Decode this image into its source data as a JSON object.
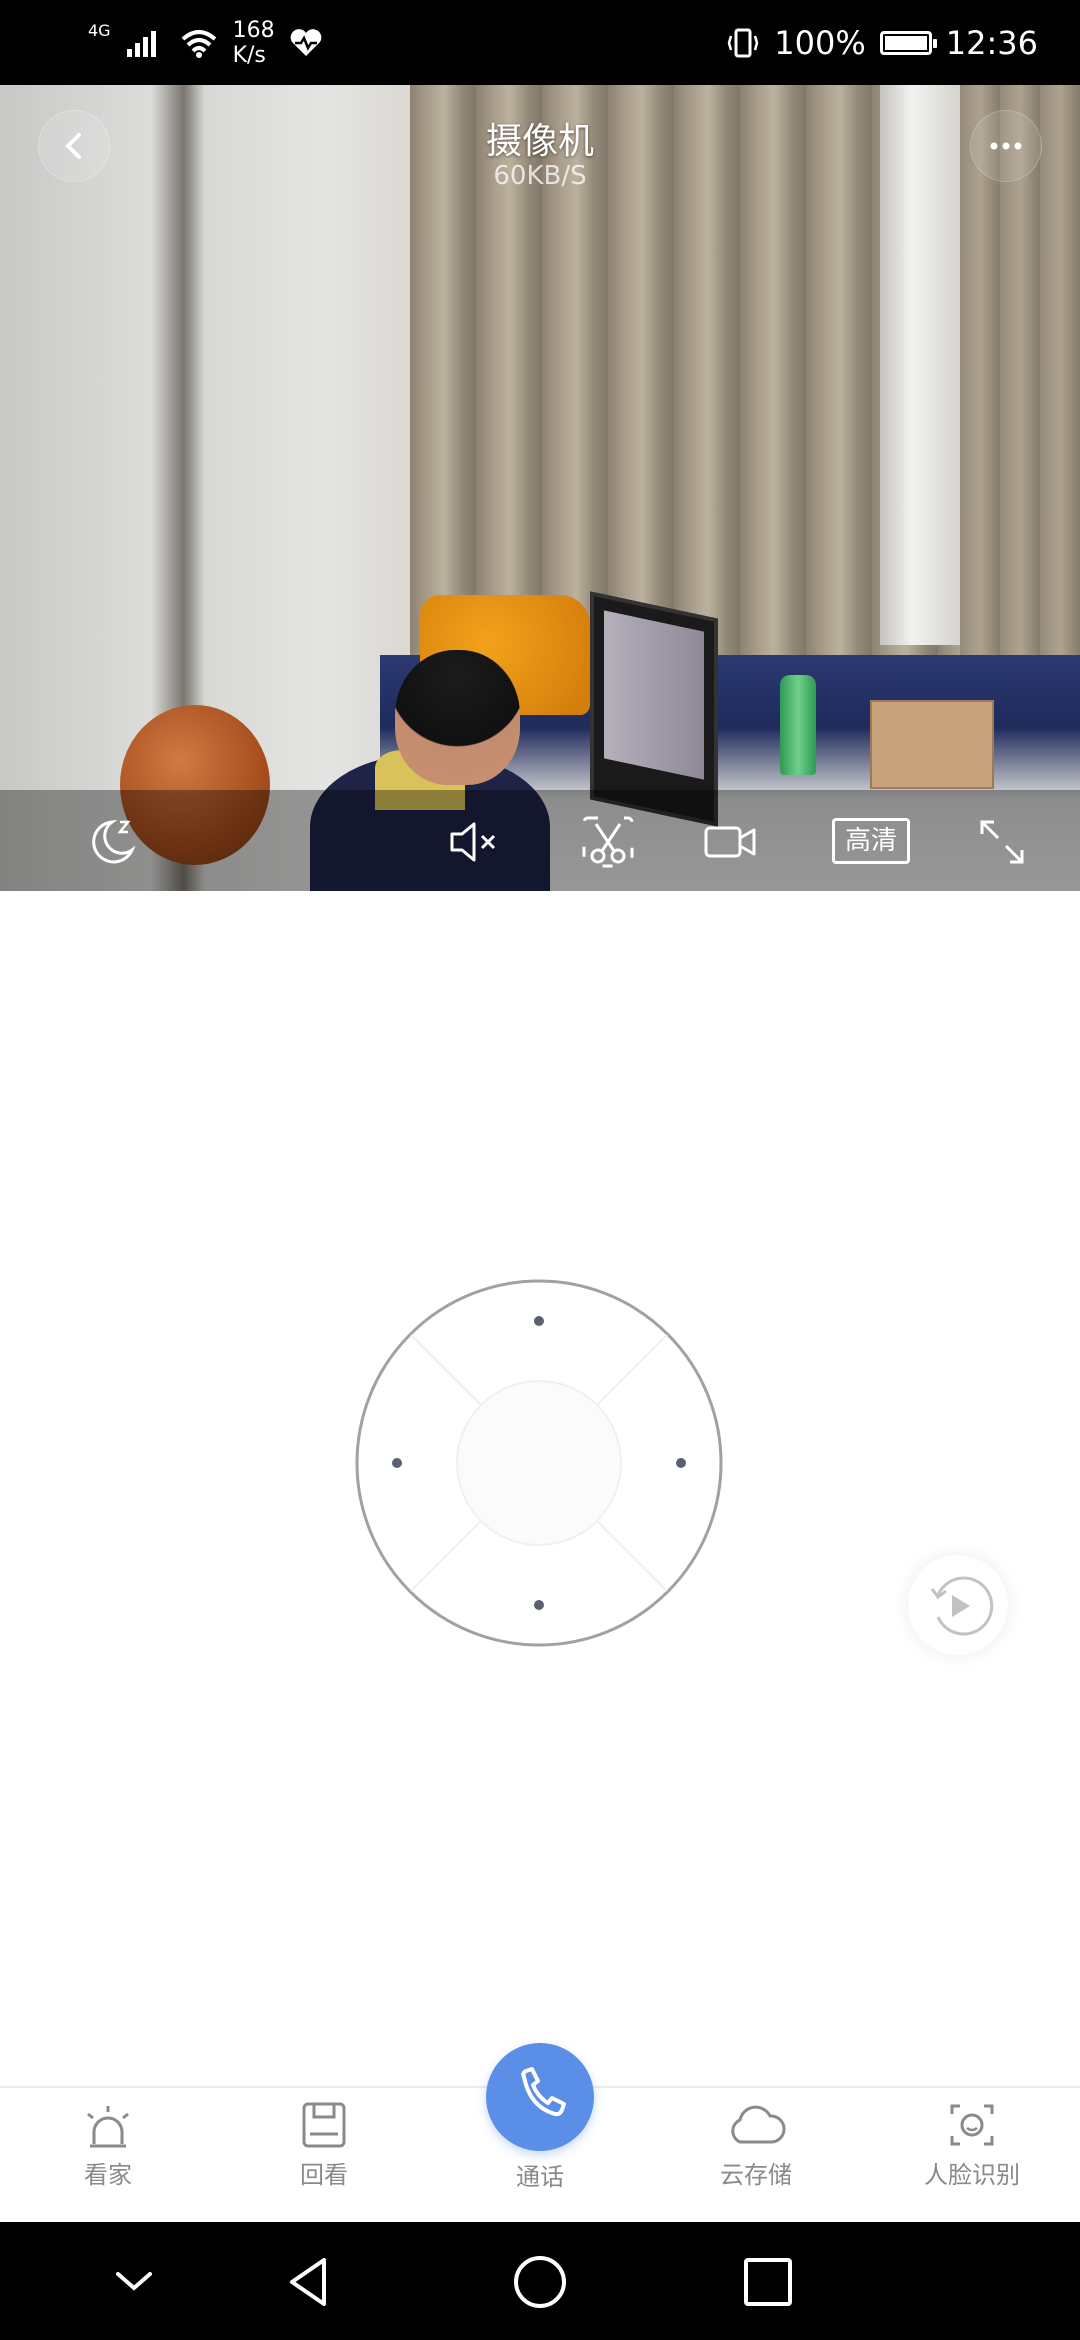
{
  "status_bar": {
    "network": "4G",
    "speed_value": "168",
    "speed_unit": "K/s",
    "battery": "100%",
    "battery_level": 1.0,
    "time": "12:36"
  },
  "video": {
    "title": "摄像机",
    "bitrate": "60KB/S",
    "quality_label": "高清",
    "controls": [
      "night-mode",
      "mute",
      "screenshot",
      "record",
      "quality",
      "fullscreen"
    ]
  },
  "tabs": [
    {
      "label": "看家",
      "icon": "alarm-icon"
    },
    {
      "label": "回看",
      "icon": "playback-icon"
    },
    {
      "label": "通话",
      "icon": "phone-icon"
    },
    {
      "label": "云存储",
      "icon": "cloud-icon"
    },
    {
      "label": "人脸识别",
      "icon": "face-recognition-icon"
    }
  ],
  "colors": {
    "accent": "#5b8ee6",
    "tab_text": "#8a8a8a"
  }
}
